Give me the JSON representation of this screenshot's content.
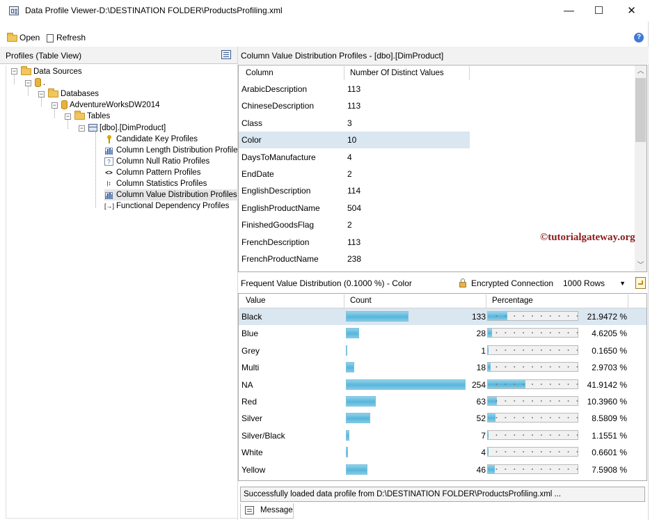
{
  "window": {
    "title": "Data Profile Viewer-D:\\DESTINATION FOLDER\\ProductsProfiling.xml",
    "minimize": "—",
    "maximize": "☐",
    "close": "✕"
  },
  "toolbar": {
    "open_label": "Open",
    "refresh_label": "Refresh",
    "help": "?"
  },
  "left_pane": {
    "title": "Profiles (Table View)",
    "tree": {
      "data_sources": "Data Sources",
      "server": ".",
      "databases": "Databases",
      "database": "AdventureWorksDW2014",
      "tables": "Tables",
      "table": "[dbo].[DimProduct]",
      "profiles": [
        "Candidate Key Profiles",
        "Column Length Distribution Profiles",
        "Column Null Ratio Profiles",
        "Column Pattern Profiles",
        "Column Statistics Profiles",
        "Column Value Distribution Profiles",
        "Functional Dependency Profiles"
      ]
    }
  },
  "column_profiles": {
    "title": "Column Value Distribution Profiles  -  [dbo].[DimProduct]",
    "headers": [
      "Column",
      "Number Of Distinct Values"
    ],
    "rows": [
      [
        "ArabicDescription",
        "113"
      ],
      [
        "ChineseDescription",
        "113"
      ],
      [
        "Class",
        "3"
      ],
      [
        "Color",
        "10"
      ],
      [
        "DaysToManufacture",
        "4"
      ],
      [
        "EndDate",
        "2"
      ],
      [
        "EnglishDescription",
        "114"
      ],
      [
        "EnglishProductName",
        "504"
      ],
      [
        "FinishedGoodsFlag",
        "2"
      ],
      [
        "FrenchDescription",
        "113"
      ],
      [
        "FrenchProductName",
        "238"
      ]
    ],
    "selected_row": 3
  },
  "watermark": "©tutorialgateway.org",
  "frequent": {
    "title": "Frequent Value Distribution (0.1000 %) - Color",
    "encrypted_label": "Encrypted Connection",
    "rows_option": "1000 Rows",
    "headers": [
      "Value",
      "Count",
      "Percentage"
    ],
    "max_count": 254,
    "rows": [
      {
        "value": "Black",
        "count": "133",
        "n": 133,
        "pct": "21.9472 %",
        "p": 21.9472
      },
      {
        "value": "Blue",
        "count": "28",
        "n": 28,
        "pct": "4.6205 %",
        "p": 4.6205
      },
      {
        "value": "Grey",
        "count": "1",
        "n": 1,
        "pct": "0.1650 %",
        "p": 0.165
      },
      {
        "value": "Multi",
        "count": "18",
        "n": 18,
        "pct": "2.9703 %",
        "p": 2.9703
      },
      {
        "value": "NA",
        "count": "254",
        "n": 254,
        "pct": "41.9142 %",
        "p": 41.9142
      },
      {
        "value": "Red",
        "count": "63",
        "n": 63,
        "pct": "10.3960 %",
        "p": 10.396
      },
      {
        "value": "Silver",
        "count": "52",
        "n": 52,
        "pct": "8.5809 %",
        "p": 8.5809
      },
      {
        "value": "Silver/Black",
        "count": "7",
        "n": 7,
        "pct": "1.1551 %",
        "p": 1.1551
      },
      {
        "value": "White",
        "count": "4",
        "n": 4,
        "pct": "0.6601 %",
        "p": 0.6601
      },
      {
        "value": "Yellow",
        "count": "46",
        "n": 46,
        "pct": "7.5908 %",
        "p": 7.5908
      }
    ],
    "selected_row": 0
  },
  "status": {
    "message": "Successfully loaded data profile from D:\\DESTINATION FOLDER\\ProductsProfiling.xml ...",
    "message_tab": "Message"
  }
}
